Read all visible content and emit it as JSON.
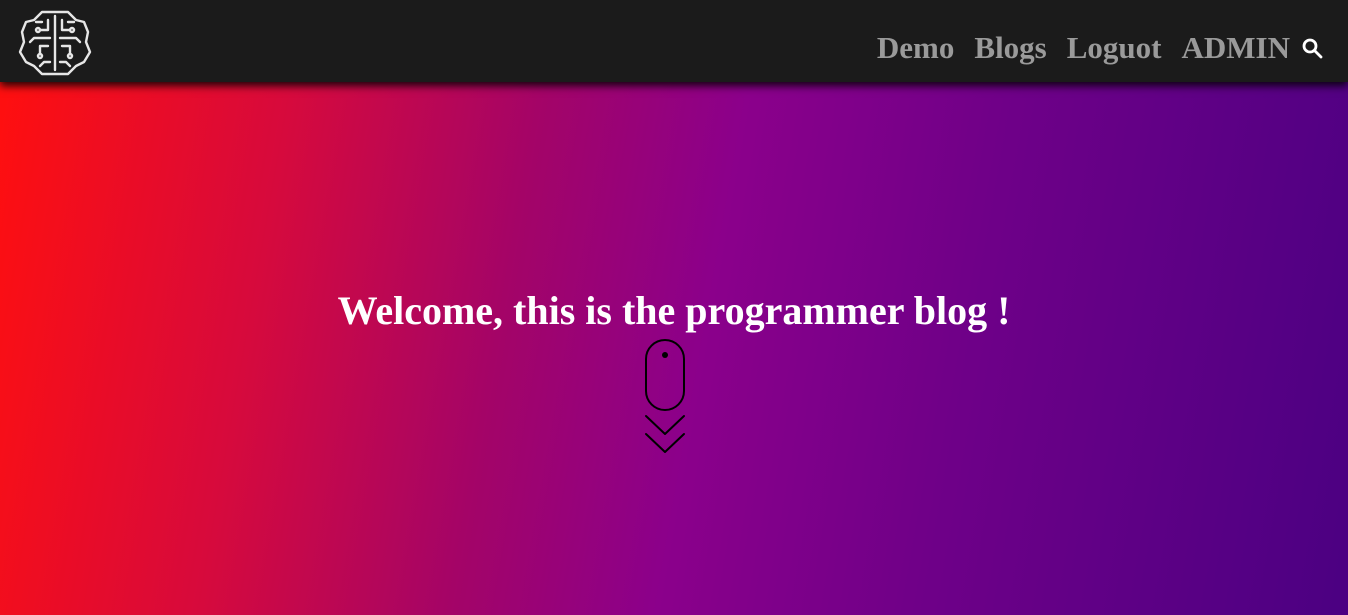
{
  "nav": {
    "logo_icon": "brain-circuit-icon",
    "links": [
      "Demo",
      "Blogs",
      "Loguot",
      "ADMIN"
    ],
    "search_icon": "search-icon"
  },
  "hero": {
    "title": "Welcome, this is the programmer blog !",
    "scroll_icon": "mouse-scroll-down-icon"
  },
  "colors": {
    "navbar_bg": "#1b1b1b",
    "nav_link": "#9a9a9a",
    "gradient_start": "#ff0f0f",
    "gradient_mid": "#8b008b",
    "gradient_end": "#4b0082",
    "title": "#ffffff"
  }
}
